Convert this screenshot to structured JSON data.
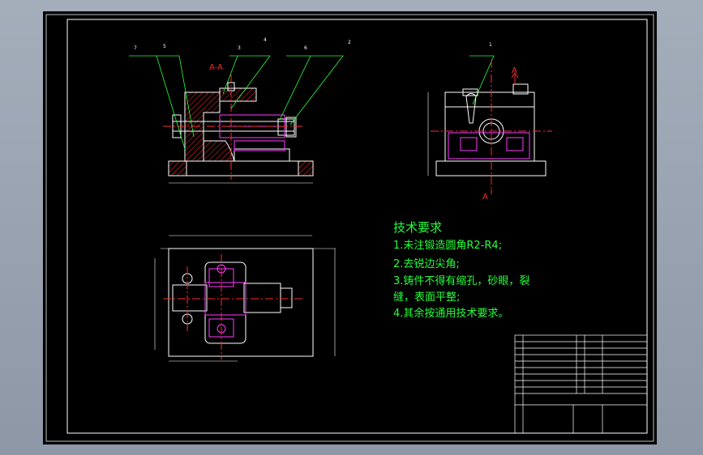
{
  "section_label": "A-A",
  "section_mark": "A",
  "balloons": [
    "7",
    "5",
    "3",
    "4",
    "6",
    "2",
    "1"
  ],
  "requirements": {
    "title": "技术要求",
    "items": [
      "1.未注锻造圆角R2-R4;",
      "2.去锐边尖角;",
      "3.铸件不得有缩孔，砂眼，裂",
      "缝，表面平整;",
      "4.其余按通用技术要求。"
    ]
  },
  "colors": {
    "frame": "#ffffff",
    "outline": "#ffffff",
    "hatch": "#ff2a2a",
    "hidden": "#ff3cff",
    "leader": "#27ff3b",
    "center": "#ff2a2a",
    "text": "#27ff3b"
  }
}
